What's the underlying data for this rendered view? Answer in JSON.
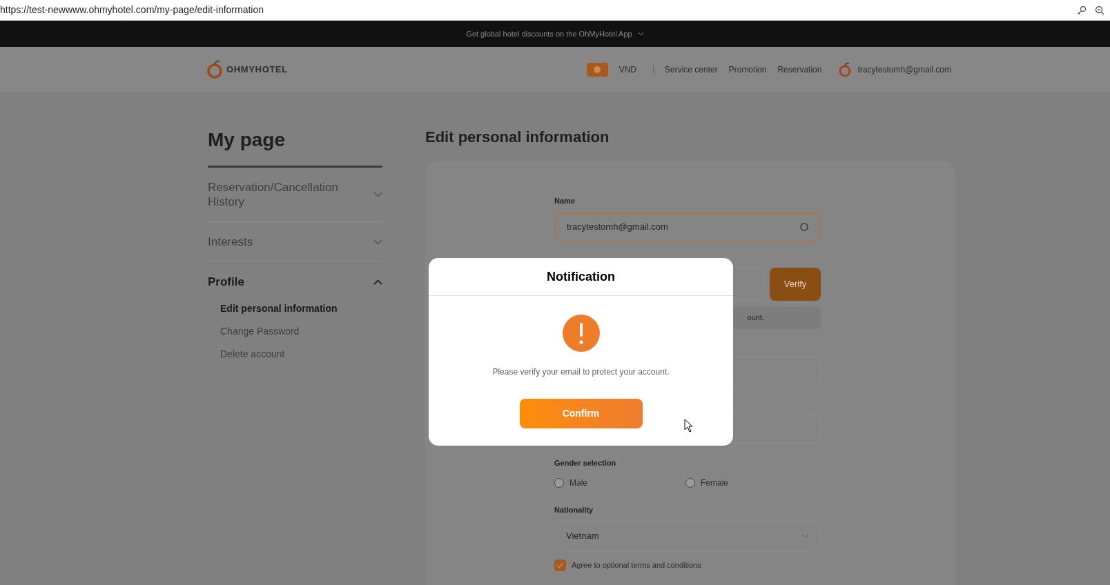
{
  "address_bar": {
    "url": "https://test-newwww.ohmyhotel.com/my-page/edit-information"
  },
  "promo_banner": {
    "text": "Get global hotel discounts on the OhMyHotel App"
  },
  "header": {
    "logo": "OHMYHOTEL",
    "currency": "VND",
    "nav": [
      "Service center",
      "Promotion",
      "Reservation"
    ],
    "account": "tracytestomh@gmail.com"
  },
  "sidebar": {
    "title": "My page",
    "sections": [
      {
        "label": "Reservation/Cancellation History",
        "expanded": false
      },
      {
        "label": "Interests",
        "expanded": false
      },
      {
        "label": "Profile",
        "expanded": true,
        "children": [
          {
            "label": "Edit personal information",
            "selected": true
          },
          {
            "label": "Change Password",
            "selected": false
          },
          {
            "label": "Delete account",
            "selected": false
          }
        ]
      }
    ]
  },
  "form": {
    "title": "Edit personal information",
    "name_label": "Name",
    "name_value": "tracytestomh@gmail.com",
    "verify_button": "Verify",
    "hint_fragment": "ount.",
    "gender_label": "Gender selection",
    "genders": [
      {
        "label": "Male",
        "selected": false
      },
      {
        "label": "Female",
        "selected": false
      }
    ],
    "nationality_label": "Nationality",
    "nationality": "Vietnam",
    "terms": {
      "label": "Agree to optional terms and conditions",
      "checked": true
    }
  },
  "dialog": {
    "title": "Notification",
    "message": "Please verify your email to protect your account.",
    "button": "Confirm"
  }
}
